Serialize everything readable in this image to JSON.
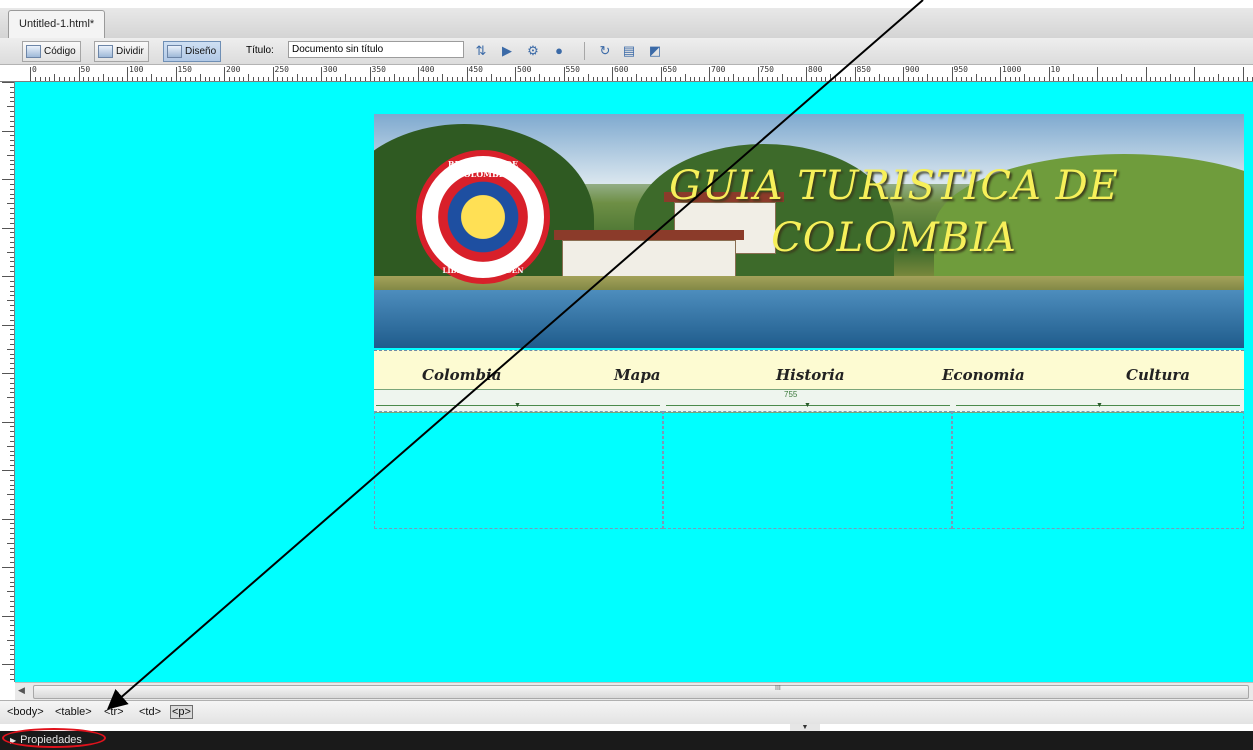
{
  "document_tab": {
    "label": "Untitled-1.html*"
  },
  "toolbar": {
    "code_label": "Código",
    "split_label": "Dividir",
    "design_label": "Diseño",
    "title_label": "Título:",
    "title_value": "Documento sin título"
  },
  "ruler": {
    "top_numbers": [
      "0",
      "50",
      "100",
      "150",
      "200",
      "250",
      "300",
      "350",
      "400",
      "450",
      "500",
      "550",
      "600",
      "650",
      "700",
      "750",
      "800",
      "850",
      "900",
      "950",
      "1000",
      "10"
    ]
  },
  "banner": {
    "title": "GUIA TURISTICA DE COLOMBIA",
    "seal_text_top": "REPUBLICA DE COLOMBIA",
    "seal_text_bottom": "LIBERTAD Y ORDEN"
  },
  "menu": {
    "items": [
      "Colombia",
      "Mapa",
      "Historia",
      "Economia",
      "Cultura"
    ]
  },
  "table_width_label": "755",
  "hscroll": {
    "grip": "III"
  },
  "tag_selector": {
    "tags": [
      "<body>",
      "<table>",
      "<tr>",
      "<td>",
      "<p>"
    ]
  },
  "properties": {
    "label": "Propiedades"
  },
  "colors": {
    "canvas_background": "#00ffff",
    "menu_background": "#fdfbd2",
    "banner_title": "#f7f05a",
    "annotation_ring": "#e0121c"
  }
}
